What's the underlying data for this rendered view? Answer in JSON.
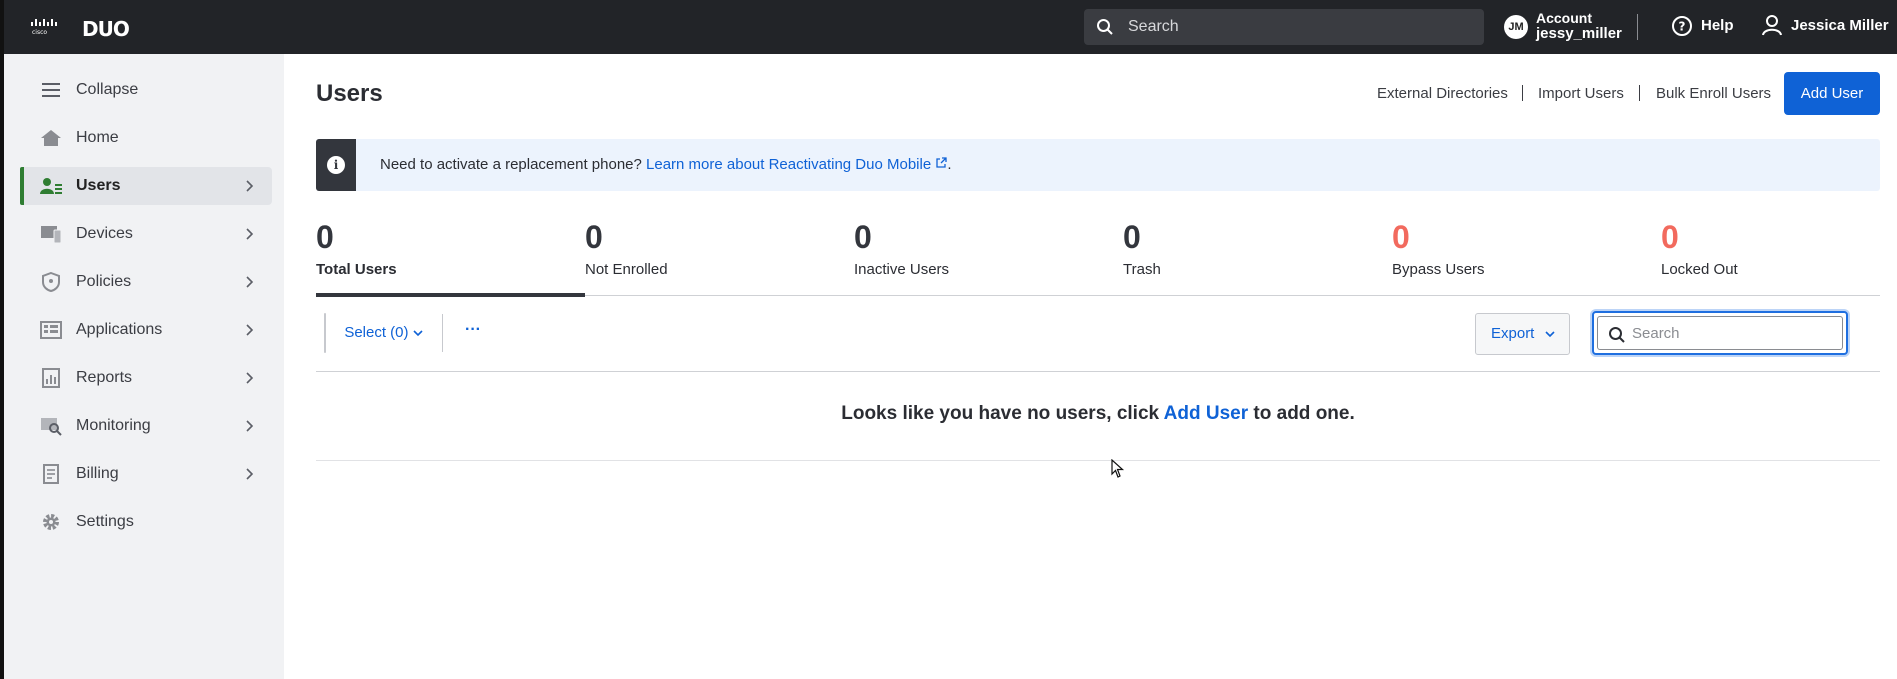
{
  "topbar": {
    "brand_cisco": "cisco",
    "brand_duo": "DUO",
    "search_placeholder": "Search",
    "account_initials": "JM",
    "account_label": "Account",
    "account_username": "jessy_miller",
    "help_label": "Help",
    "user_name": "Jessica Miller"
  },
  "sidebar": {
    "items": [
      {
        "label": "Collapse",
        "icon": "hamburger-icon"
      },
      {
        "label": "Home",
        "icon": "home-icon"
      },
      {
        "label": "Users",
        "icon": "users-icon",
        "active": true
      },
      {
        "label": "Devices",
        "icon": "devices-icon"
      },
      {
        "label": "Policies",
        "icon": "shield-icon"
      },
      {
        "label": "Applications",
        "icon": "applications-icon"
      },
      {
        "label": "Reports",
        "icon": "reports-icon"
      },
      {
        "label": "Monitoring",
        "icon": "monitoring-icon"
      },
      {
        "label": "Billing",
        "icon": "billing-icon"
      },
      {
        "label": "Settings",
        "icon": "gear-icon"
      }
    ]
  },
  "header": {
    "title": "Users",
    "links": [
      "External Directories",
      "Import Users",
      "Bulk Enroll Users"
    ],
    "add_user": "Add User"
  },
  "banner": {
    "text": "Need to activate a replacement phone? ",
    "link": "Learn more about Reactivating Duo Mobile",
    "suffix": "."
  },
  "stats": [
    {
      "value": "0",
      "label": "Total Users",
      "active": true
    },
    {
      "value": "0",
      "label": "Not Enrolled"
    },
    {
      "value": "0",
      "label": "Inactive Users"
    },
    {
      "value": "0",
      "label": "Trash"
    },
    {
      "value": "0",
      "label": "Bypass Users",
      "alert": true
    },
    {
      "value": "0",
      "label": "Locked Out",
      "alert": true
    }
  ],
  "toolbar": {
    "select_label": "Select (0)",
    "more_label": "···",
    "export_label": "Export",
    "search_placeholder": "Search"
  },
  "empty": {
    "before": "Looks like you have no users, click ",
    "link": "Add User",
    "after": " to add one."
  },
  "colors": {
    "topbar": "#222428",
    "accent": "#0f62d6",
    "active_bar": "#2f7d32",
    "alert": "#f26a5e"
  }
}
